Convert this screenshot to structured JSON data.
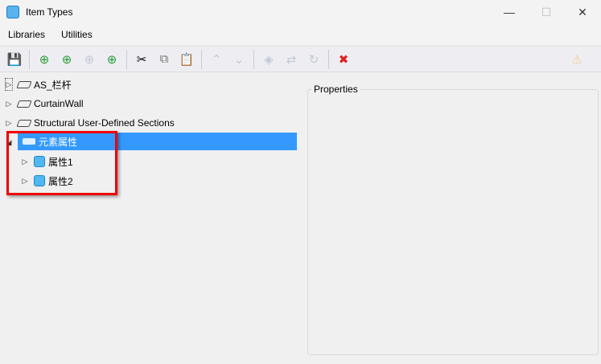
{
  "window": {
    "title": "Item Types",
    "minimize": "—",
    "maximize": "☐",
    "close": "✕"
  },
  "menu": [
    "Libraries",
    "Utilities"
  ],
  "toolbar": {
    "save": "💾",
    "add_library": "⊕",
    "add_item": "⊕",
    "add_other": "⊕",
    "add_definition": "⊕",
    "cut": "✂",
    "copy": "⧉",
    "paste": "📋",
    "up": "⌃",
    "down": "⌄",
    "t1": "◈",
    "t2": "⇄",
    "t3": "↻",
    "delete": "✖",
    "warning": "⚠"
  },
  "tree": [
    {
      "label": "AS_栏杆",
      "expanded": false
    },
    {
      "label": "CurtainWall",
      "expanded": false
    },
    {
      "label": "Structural User-Defined Sections",
      "expanded": false
    },
    {
      "label": "元素属性",
      "expanded": true,
      "selected": true,
      "children": [
        {
          "label": "属性1"
        },
        {
          "label": "属性2"
        }
      ]
    }
  ],
  "properties": {
    "label": "Properties"
  }
}
